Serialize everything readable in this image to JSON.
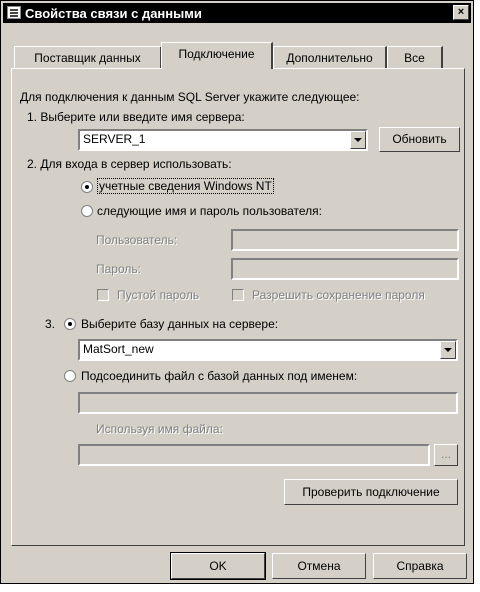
{
  "window": {
    "title": "Свойства связи с данными",
    "close_label": "×"
  },
  "tabs": [
    {
      "label": "Поставщик данных",
      "active": false
    },
    {
      "label": "Подключение",
      "active": true
    },
    {
      "label": "Дополнительно",
      "active": false
    },
    {
      "label": "Все",
      "active": false
    }
  ],
  "intro_text": "Для подключения к данным SQL Server укажите следующее:",
  "step1": {
    "label": "1. Выберите или введите имя сервера:",
    "server_value": "SERVER_1",
    "refresh_button": "Обновить"
  },
  "step2": {
    "label": "2. Для входа в сервер использовать:",
    "option_nt": "учетные сведения Windows NT",
    "option_nt_selected": true,
    "option_user": "следующие имя и пароль пользователя:",
    "user_label": "Пользователь:",
    "password_label": "Пароль:",
    "blank_password": "Пустой пароль",
    "allow_save": "Разрешить сохранение пароля"
  },
  "step3": {
    "number": "3.",
    "option_db": "Выберите базу данных на сервере:",
    "option_db_selected": true,
    "database_value": "MatSort_new",
    "option_attach": "Подсоединить файл с базой данных под именем:",
    "filename_label": "Используя имя файла:",
    "browse_label": "..."
  },
  "test_button": "Проверить подключение",
  "footer": {
    "ok": "OK",
    "cancel": "Отмена",
    "help": "Справка"
  }
}
